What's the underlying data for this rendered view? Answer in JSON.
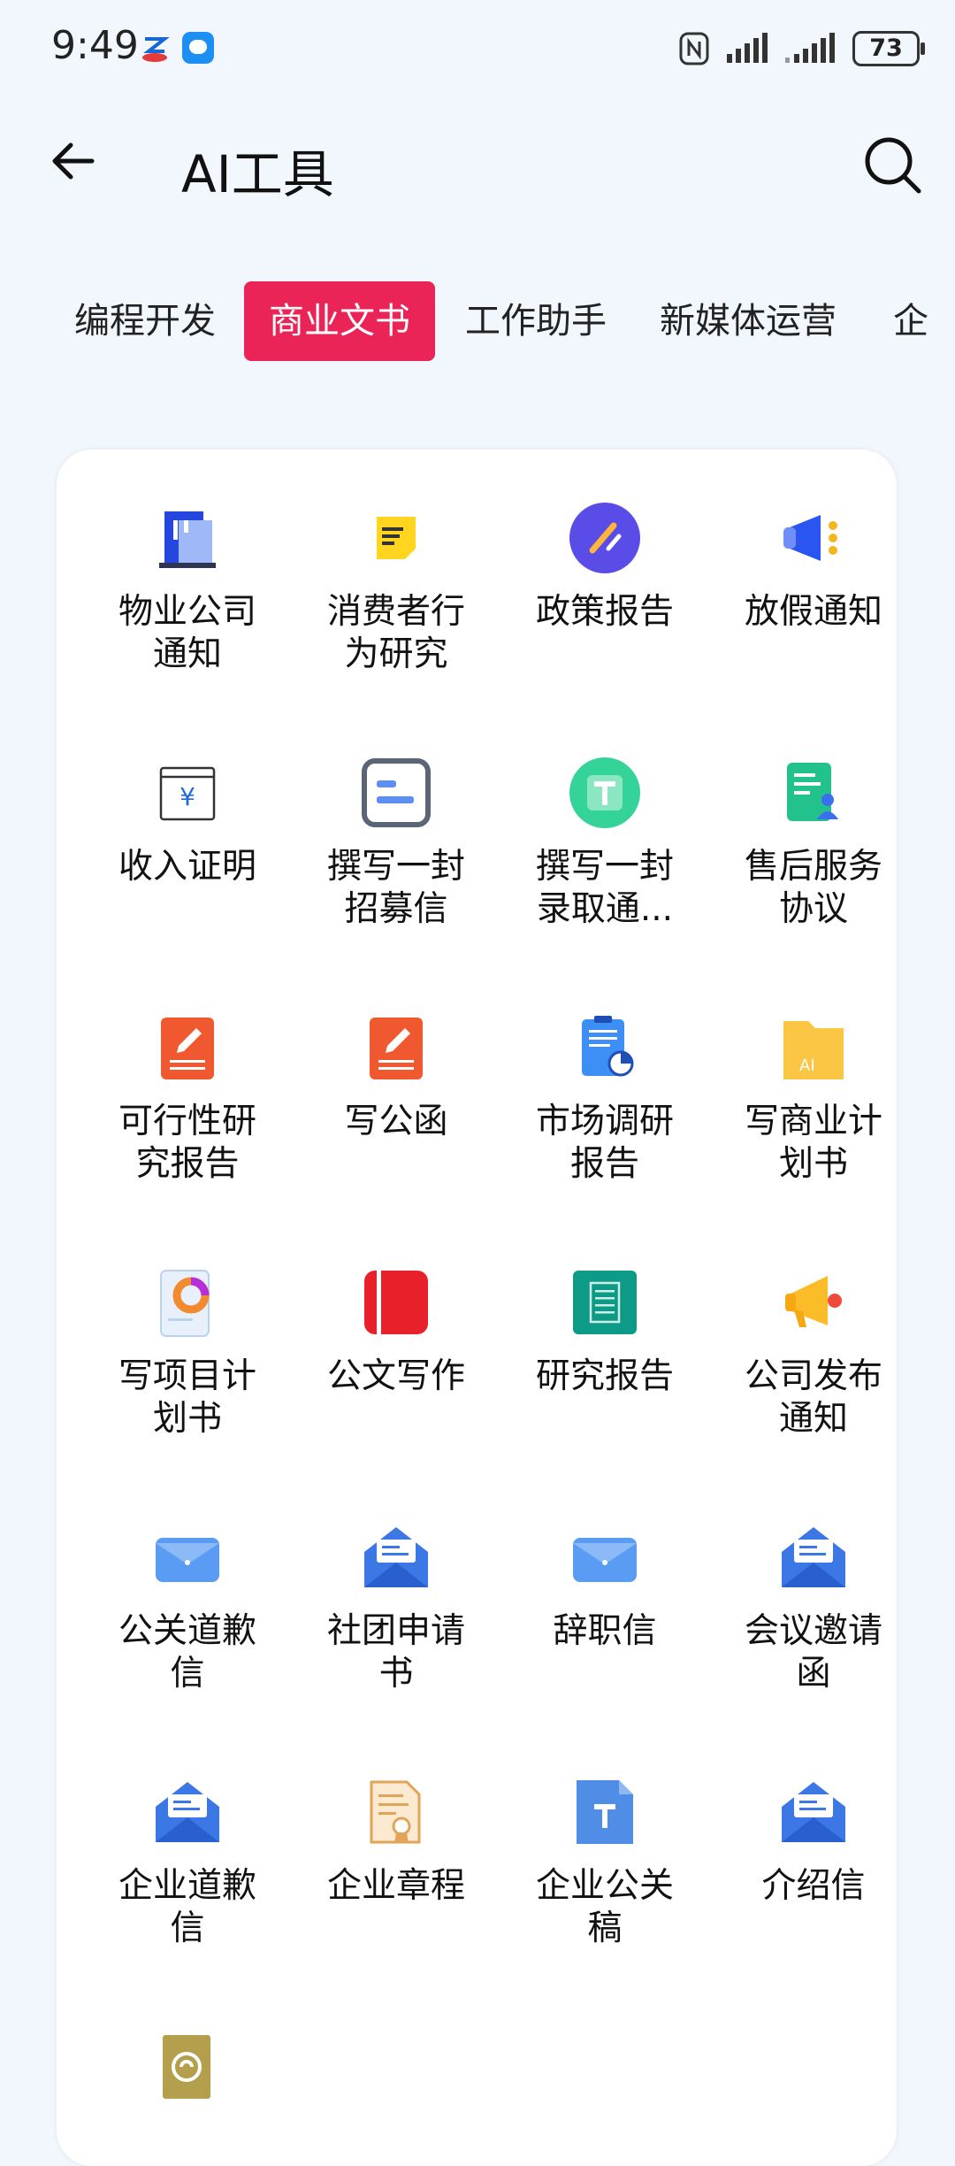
{
  "status_bar": {
    "time": "9:49",
    "battery": "73"
  },
  "header": {
    "title": "AI工具"
  },
  "tabs": [
    "编程开发",
    "商业文书",
    "工作助手",
    "新媒体运营",
    "企"
  ],
  "active_tab": 1,
  "tools": [
    {
      "label": "物业公司\n通知",
      "icon": "building-icon"
    },
    {
      "label": "消费者行\n为研究",
      "icon": "note-icon"
    },
    {
      "label": "政策报告",
      "icon": "pen-circle-icon"
    },
    {
      "label": "放假通知",
      "icon": "megaphone-icon"
    },
    {
      "label": "收入证明",
      "icon": "yuan-doc-icon"
    },
    {
      "label": "撰写一封\n招募信",
      "icon": "form-icon"
    },
    {
      "label": "撰写一封\n录取通...",
      "icon": "t-circle-icon"
    },
    {
      "label": "售后服务\n协议",
      "icon": "doc-user-icon"
    },
    {
      "label": "可行性研\n究报告",
      "icon": "edit-doc-icon"
    },
    {
      "label": "写公函",
      "icon": "edit-doc-icon"
    },
    {
      "label": "市场调研\n报告",
      "icon": "clipboard-chart-icon"
    },
    {
      "label": "写商业计\n划书",
      "icon": "ai-folder-icon"
    },
    {
      "label": "写项目计\n划书",
      "icon": "donut-doc-icon"
    },
    {
      "label": "公文写作",
      "icon": "red-book-icon"
    },
    {
      "label": "研究报告",
      "icon": "notepad-icon"
    },
    {
      "label": "公司发布\n通知",
      "icon": "loudspeaker-icon"
    },
    {
      "label": "公关道歉\n信",
      "icon": "envelope-icon"
    },
    {
      "label": "社团申请\n书",
      "icon": "open-envelope-icon"
    },
    {
      "label": "辞职信",
      "icon": "envelope-icon"
    },
    {
      "label": "会议邀请\n函",
      "icon": "open-envelope-icon"
    },
    {
      "label": "企业道歉\n信",
      "icon": "open-envelope-icon"
    },
    {
      "label": "企业章程",
      "icon": "certificate-icon"
    },
    {
      "label": "企业公关\n稿",
      "icon": "t-doc-icon"
    },
    {
      "label": "介绍信",
      "icon": "open-envelope-icon"
    },
    {
      "label": "",
      "icon": "swirl-icon"
    }
  ],
  "colors": {
    "accent": "#ea2457",
    "background": "#f1f7fd"
  }
}
